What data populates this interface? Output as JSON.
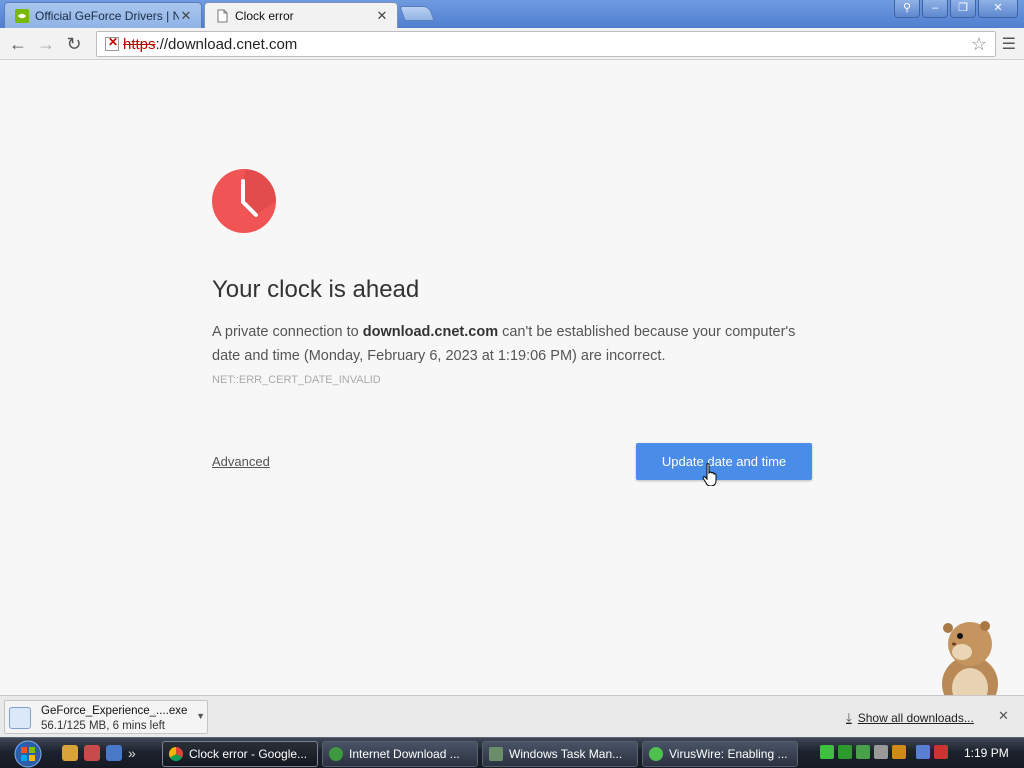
{
  "browser": {
    "tabs": [
      {
        "title": "Official GeForce Drivers | N",
        "active": false
      },
      {
        "title": "Clock error",
        "active": true
      }
    ],
    "omnibox": {
      "scheme": "https",
      "rest": "://download.cnet.com"
    }
  },
  "error_page": {
    "heading": "Your clock is ahead",
    "desc_prefix": "A private connection to ",
    "domain": "download.cnet.com",
    "desc_suffix": " can't be established because your computer's date and time (Monday, February 6, 2023 at 1:19:06 PM) are incorrect.",
    "error_code": "NET::ERR_CERT_DATE_INVALID",
    "advanced_label": "Advanced",
    "button_label": "Update date and time",
    "accent_color": "#4a8de8",
    "icon_color": "#f05454"
  },
  "downloads": {
    "item_name": "GeForce_Experience_....exe",
    "item_status": "56.1/125 MB, 6 mins left",
    "show_all": "Show all downloads..."
  },
  "taskbar": {
    "buttons": [
      {
        "label": "Clock error - Google..."
      },
      {
        "label": "Internet Download ..."
      },
      {
        "label": "Windows Task Man..."
      },
      {
        "label": "VirusWire: Enabling ..."
      }
    ],
    "clock": "1:19 PM"
  }
}
